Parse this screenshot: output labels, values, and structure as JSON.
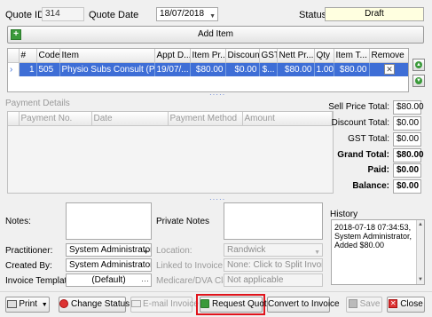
{
  "header": {
    "quote_id_label": "Quote ID:",
    "quote_id_value": "314",
    "quote_date_label": "Quote Date",
    "quote_date_value": "18/07/2018",
    "status_label": "Status:",
    "status_value": "Draft"
  },
  "add_item_label": "Add Item",
  "items_table": {
    "columns": [
      "#",
      "Code",
      "Item",
      "Appt D...",
      "Item Pr...",
      "Discount",
      "GST",
      "Nett Pr...",
      "Qty",
      "Item T...",
      "Remove"
    ],
    "rows": [
      {
        "num": "1",
        "code": "505",
        "item": "Physio Subs Consult (Pvte ...",
        "appt": "19/07/...",
        "item_price": "$80.00",
        "discount": "$0.00",
        "gst": "$...",
        "nett_price": "$80.00",
        "qty": "1.00",
        "item_total": "$80.00"
      }
    ]
  },
  "payment_details": {
    "title": "Payment Details",
    "columns": [
      "Payment No.",
      "Date",
      "Payment Method",
      "Amount"
    ]
  },
  "totals": {
    "sell_price_label": "Sell Price Total:",
    "sell_price_value": "$80.00",
    "discount_label": "Discount Total:",
    "discount_value": "$0.00",
    "gst_label": "GST Total:",
    "gst_value": "$0.00",
    "grand_label": "Grand Total:",
    "grand_value": "$80.00",
    "paid_label": "Paid:",
    "paid_value": "$0.00",
    "balance_label": "Balance:",
    "balance_value": "$0.00"
  },
  "form": {
    "notes_label": "Notes:",
    "private_notes_label": "Private Notes",
    "history_label": "History",
    "history_text": "2018-07-18 07:34:53, System Administrator, Added $80.00",
    "practitioner_label": "Practitioner:",
    "practitioner_value": "System Administrator",
    "location_label": "Location:",
    "location_value": "Randwick",
    "created_by_label": "Created By:",
    "created_by_value": "System Administrator",
    "linked_invoice_label": "Linked to Invoice...",
    "linked_invoice_value": "None: Click to Split Invoice ...",
    "invoice_template_label": "Invoice Template:",
    "invoice_template_value": "(Default)",
    "medicare_label": "Medicare/DVA Claim:",
    "medicare_value": "Not applicable"
  },
  "buttons": {
    "print": "Print",
    "change_status": "Change Status",
    "email_invoice": "E-mail Invoice",
    "request_quote": "Request Quote",
    "convert_to_invoice": "Convert to Invoice",
    "save": "Save",
    "close": "Close"
  },
  "colors": {
    "selection": "#3e6ed6",
    "highlight_outline": "#e0141c",
    "status_bg": "#ffffe0"
  }
}
